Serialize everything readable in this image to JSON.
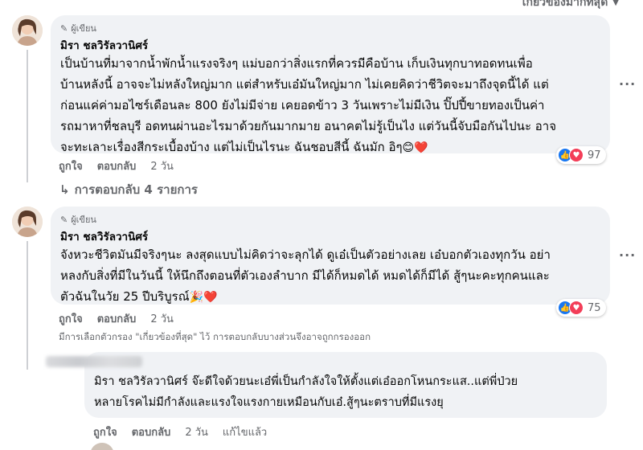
{
  "sort": {
    "label": "เกี่ยวข้องมากที่สุด"
  },
  "comment1": {
    "badge": "ผู้เขียน",
    "author": "มิรา ชลวิรัลวานิศร์",
    "lines": [
      "เป็นบ้านที่มาจากน้ำพักน้ำแรงจริงๆ แม่บอกว่าสิ่งแรกที่ควรมีคือบ้าน เก็บเงินทุกบาทอดทนเพื่อ",
      "บ้านหลังนี้ อาจจะไม่หลังใหญ่มาก แต่สำหรับเอ๋มันใหญ่มาก ไม่เคยคิดว่าชีวิตจะมาถึงจุดนี้ได้ แต่",
      "ก่อนแค่ค่ามอไซร์เดือนละ 800 ยังไม่มีจ่าย เคยอดข้าว 3 วันเพราะไม่มีเงิน ปิ๊ปปี้ขายทองเป็นค่า",
      "รถมาหาที่ชลบุรี อดทนผ่านอะไรมาด้วยกันมากมาย อนาคตไม่รู้เป็นไง แต่วันนี้จับมือกันไปนะ อาจ",
      "จะทะเลาะเรื่องสีกระเบื้องบ้าง แต่ไม่เป็นไรนะ ฉันชอบสีนี้ ฉันมัก อิๆ"
    ],
    "emoji": "😊❤️",
    "reaction_count": "97",
    "like": "ถูกใจ",
    "reply": "ตอบกลับ",
    "time": "2 วัน",
    "replies_link": "การตอบกลับ 4 รายการ"
  },
  "comment2": {
    "badge": "ผู้เขียน",
    "author": "มิรา ชลวิรัลวานิศร์",
    "lines": [
      "จังหวะชีวิตมันมีจริงๆนะ ลงสุดแบบไม่คิดว่าจะลุกได้ ดูเอ๋เป็นตัวอย่างเลย เอ๋บอกตัวเองทุกวัน อย่า",
      "หลงกับสิ่งที่มีในวันนี้ ให้นึกถึงตอนที่ตัวเองลำบาก มีได้ก็หมดได้ หมดได้ก็มีได้ สู้ๆนะคะทุกคนและ",
      "ตัวฉันในวัย 25 ปีบริบูรณ์"
    ],
    "emoji": "🎉❤️",
    "reaction_count": "75",
    "like": "ถูกใจ",
    "reply": "ตอบกลับ",
    "time": "2 วัน",
    "filter_note": "มีการเลือกตัวกรอง \"เกี่ยวข้องที่สุด\" ไว้ การตอบกลับบางส่วนจึงอาจถูกกรองออก"
  },
  "reply1": {
    "lines": [
      "มิรา ชลวิรัลวานิศร์ จ๊ะดีใจด้วยนะเอ๋พี่เป็นกำลังใจให้ตั้งแต่เอ๋ออกโหนกระแส..แต่พี่ป่วย",
      "หลายโรคไม่มีกำลังและแรงใจแรงกายเหมือนกับเอ๋.สู้ๆนะตราบที่มีแรงยุ"
    ],
    "like": "ถูกใจ",
    "reply": "ตอบกลับ",
    "time": "2 วัน",
    "edited": "แก้ไขแล้ว"
  },
  "colors": {
    "bubble": "#f0f2f5",
    "secondary_text": "#65676b",
    "like_blue": "#1877f2",
    "love_red": "#f33e58"
  }
}
